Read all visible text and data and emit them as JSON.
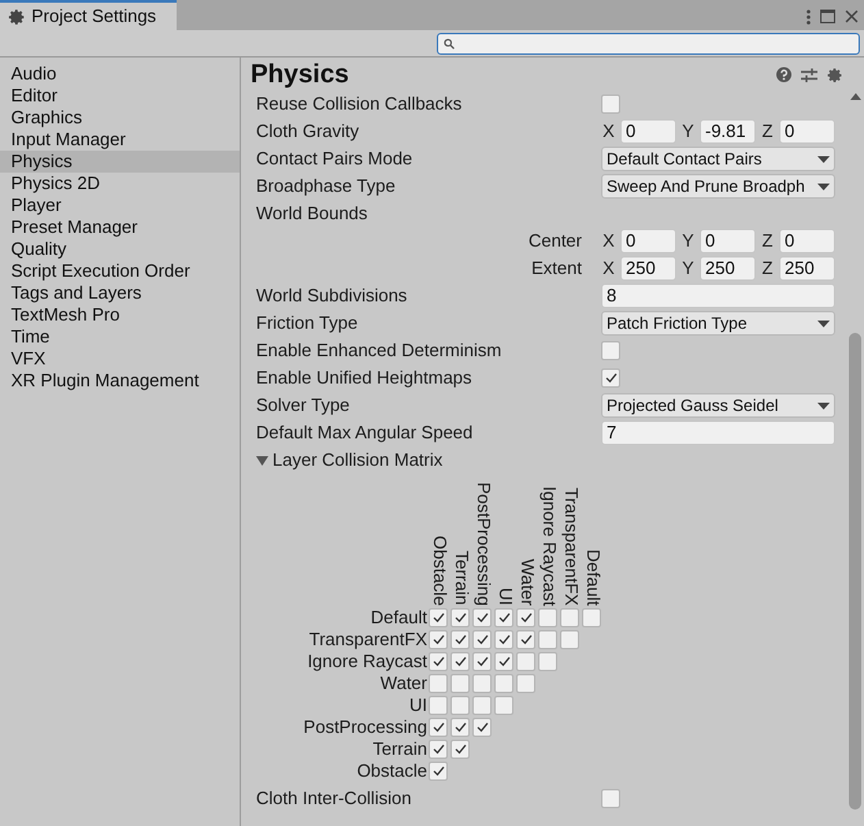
{
  "window": {
    "title": "Project Settings"
  },
  "sidebar": {
    "items": [
      {
        "label": "Audio",
        "selected": false
      },
      {
        "label": "Editor",
        "selected": false
      },
      {
        "label": "Graphics",
        "selected": false
      },
      {
        "label": "Input Manager",
        "selected": false
      },
      {
        "label": "Physics",
        "selected": true
      },
      {
        "label": "Physics 2D",
        "selected": false
      },
      {
        "label": "Player",
        "selected": false
      },
      {
        "label": "Preset Manager",
        "selected": false
      },
      {
        "label": "Quality",
        "selected": false
      },
      {
        "label": "Script Execution Order",
        "selected": false
      },
      {
        "label": "Tags and Layers",
        "selected": false
      },
      {
        "label": "TextMesh Pro",
        "selected": false
      },
      {
        "label": "Time",
        "selected": false
      },
      {
        "label": "VFX",
        "selected": false
      },
      {
        "label": "XR Plugin Management",
        "selected": false
      }
    ]
  },
  "page": {
    "title": "Physics"
  },
  "settings": [
    {
      "kind": "checkbox",
      "label": "Reuse Collision Callbacks",
      "checked": false
    },
    {
      "kind": "vector",
      "label": "Cloth Gravity",
      "axes": [
        {
          "axis": "X",
          "value": "0"
        },
        {
          "axis": "Y",
          "value": "-9.81"
        },
        {
          "axis": "Z",
          "value": "0"
        }
      ]
    },
    {
      "kind": "dropdown",
      "label": "Contact Pairs Mode",
      "value": "Default Contact Pairs"
    },
    {
      "kind": "dropdown",
      "label": "Broadphase Type",
      "value": "Sweep And Prune Broadph"
    },
    {
      "kind": "heading",
      "label": "World Bounds"
    },
    {
      "kind": "subvector",
      "label": "Center",
      "axes": [
        {
          "axis": "X",
          "value": "0"
        },
        {
          "axis": "Y",
          "value": "0"
        },
        {
          "axis": "Z",
          "value": "0"
        }
      ]
    },
    {
      "kind": "subvector",
      "label": "Extent",
      "axes": [
        {
          "axis": "X",
          "value": "250"
        },
        {
          "axis": "Y",
          "value": "250"
        },
        {
          "axis": "Z",
          "value": "250"
        }
      ]
    },
    {
      "kind": "number",
      "label": "World Subdivisions",
      "value": "8"
    },
    {
      "kind": "dropdown",
      "label": "Friction Type",
      "value": "Patch Friction Type"
    },
    {
      "kind": "checkbox",
      "label": "Enable Enhanced Determinism",
      "checked": false
    },
    {
      "kind": "checkbox",
      "label": "Enable Unified Heightmaps",
      "checked": true
    },
    {
      "kind": "dropdown",
      "label": "Solver Type",
      "value": "Projected Gauss Seidel"
    },
    {
      "kind": "number",
      "label": "Default Max Angular Speed",
      "value": "7"
    },
    {
      "kind": "foldout",
      "label": "Layer Collision Matrix",
      "expanded": true
    }
  ],
  "matrix": {
    "columns": [
      "Obstacle",
      "Terrain",
      "PostProcessing",
      "UI",
      "Water",
      "Ignore Raycast",
      "TransparentFX",
      "Default"
    ],
    "rows": [
      {
        "label": "Default",
        "cells": [
          true,
          true,
          true,
          true,
          true,
          false,
          false,
          false
        ]
      },
      {
        "label": "TransparentFX",
        "cells": [
          true,
          true,
          true,
          true,
          true,
          false,
          false
        ]
      },
      {
        "label": "Ignore Raycast",
        "cells": [
          true,
          true,
          true,
          true,
          false,
          false
        ]
      },
      {
        "label": "Water",
        "cells": [
          false,
          false,
          false,
          false,
          false
        ]
      },
      {
        "label": "UI",
        "cells": [
          false,
          false,
          false,
          false
        ]
      },
      {
        "label": "PostProcessing",
        "cells": [
          true,
          true,
          true
        ]
      },
      {
        "label": "Terrain",
        "cells": [
          true,
          true
        ]
      },
      {
        "label": "Obstacle",
        "cells": [
          true
        ]
      }
    ]
  },
  "footer_setting": {
    "label": "Cloth Inter-Collision",
    "checked": false
  }
}
